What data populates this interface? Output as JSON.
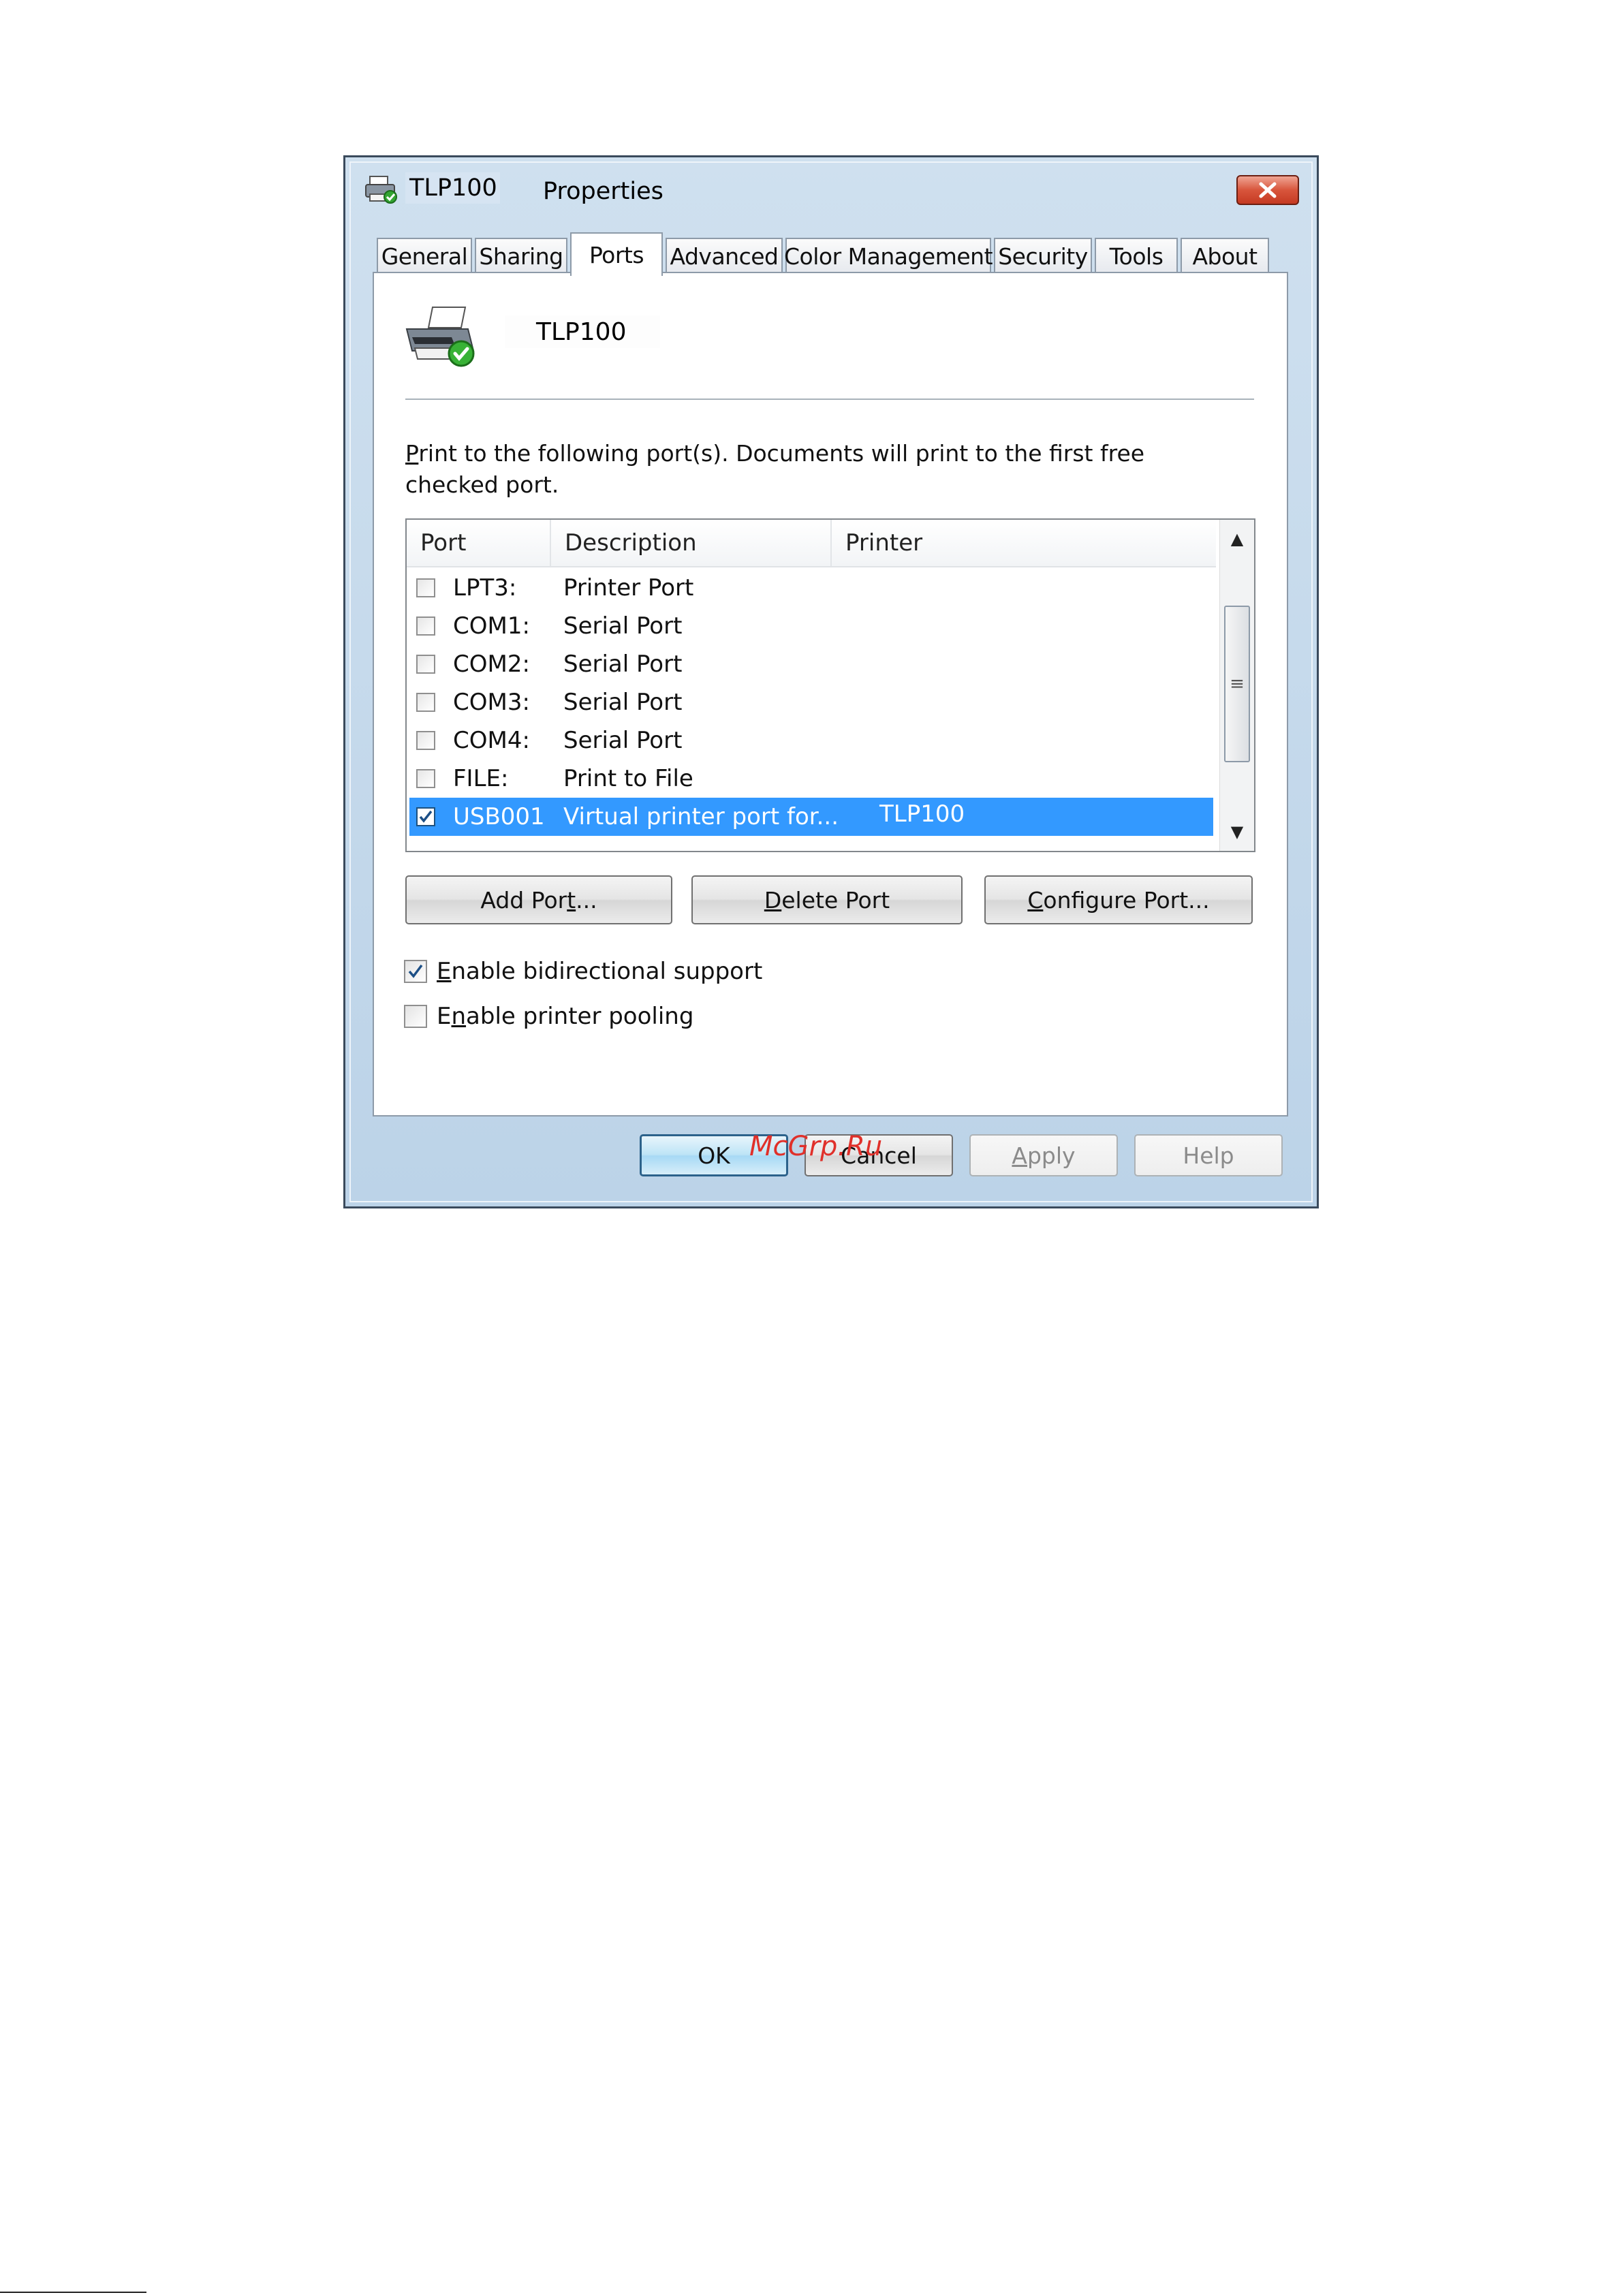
{
  "window": {
    "printer_name": "TLP100",
    "title_suffix": "Properties",
    "close_icon": "close-icon",
    "title_icon": "printer-icon"
  },
  "tabs": [
    {
      "label": "General",
      "active": false
    },
    {
      "label": "Sharing",
      "active": false
    },
    {
      "label": "Ports",
      "active": true
    },
    {
      "label": "Advanced",
      "active": false
    },
    {
      "label": "Color Management",
      "active": false
    },
    {
      "label": "Security",
      "active": false
    },
    {
      "label": "Tools",
      "active": false
    },
    {
      "label": "About",
      "active": false
    }
  ],
  "panel": {
    "printer_name": "TLP100",
    "instructions_p": "P",
    "instructions_rest": "rint to the following port(s). Documents will print to the first free checked port."
  },
  "ports_list": {
    "columns": [
      "Port",
      "Description",
      "Printer"
    ],
    "rows": [
      {
        "port": "LPT3:",
        "description": "Printer Port",
        "printer": "",
        "checked": false,
        "selected": false
      },
      {
        "port": "COM1:",
        "description": "Serial Port",
        "printer": "",
        "checked": false,
        "selected": false
      },
      {
        "port": "COM2:",
        "description": "Serial Port",
        "printer": "",
        "checked": false,
        "selected": false
      },
      {
        "port": "COM3:",
        "description": "Serial Port",
        "printer": "",
        "checked": false,
        "selected": false
      },
      {
        "port": "COM4:",
        "description": "Serial Port",
        "printer": "",
        "checked": false,
        "selected": false
      },
      {
        "port": "FILE:",
        "description": "Print to File",
        "printer": "",
        "checked": false,
        "selected": false
      },
      {
        "port": "USB001",
        "description": "Virtual printer port for...",
        "printer": "TLP100",
        "checked": true,
        "selected": true
      }
    ]
  },
  "port_buttons": {
    "add_pre": "Add Por",
    "add_key": "t",
    "add_post": "...",
    "delete_key": "D",
    "delete_post": "elete Port",
    "configure_key": "C",
    "configure_post": "onfigure Port..."
  },
  "options": {
    "bidirectional_key": "E",
    "bidirectional_rest": "nable bidirectional support",
    "bidirectional_checked": true,
    "pooling_pre": "E",
    "pooling_key": "n",
    "pooling_rest": "able printer pooling",
    "pooling_checked": false
  },
  "dialog_buttons": {
    "ok": "OK",
    "cancel": "Cancel",
    "apply_key": "A",
    "apply_rest": "pply",
    "help": "Help"
  },
  "watermark": "McGrp.Ru",
  "colors": {
    "selection": "#3399ff",
    "close_button": "#c53a22",
    "watermark": "#e0302a"
  }
}
